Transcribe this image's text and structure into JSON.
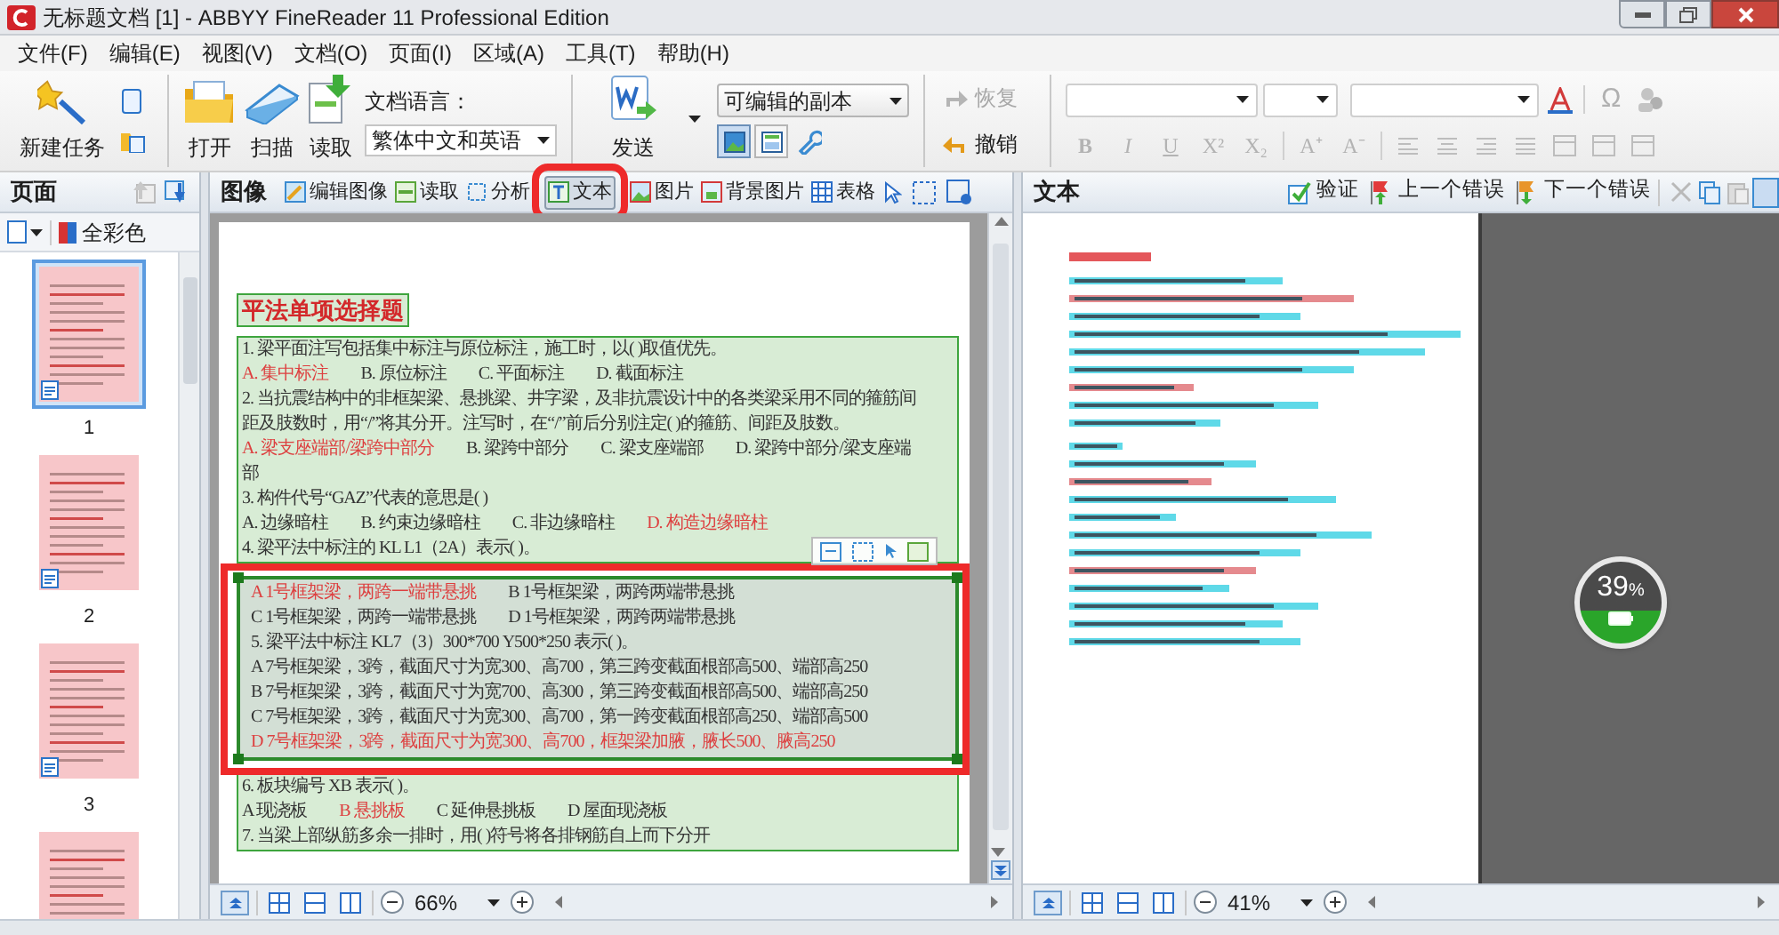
{
  "window": {
    "title": "无标题文档 [1] - ABBYY FineReader 11 Professional Edition"
  },
  "menu": [
    "文件(F)",
    "编辑(E)",
    "视图(V)",
    "文档(O)",
    "页面(I)",
    "区域(A)",
    "工具(T)",
    "帮助(H)"
  ],
  "toolbar": {
    "new_task": "新建任务",
    "main_buttons": [
      "打开",
      "扫描",
      "读取"
    ],
    "language": {
      "label": "文档语言：",
      "value": "繁体中文和英语"
    },
    "send": {
      "label": "发送",
      "format": "可编辑的副本",
      "views": [
        {
          "selected": true
        },
        {
          "selected": false
        }
      ]
    },
    "history": [
      {
        "label": "恢复",
        "disabled": true
      },
      {
        "label": "撤销",
        "disabled": false
      }
    ],
    "format_buttons": [
      "B",
      "I",
      "U",
      "X²",
      "X₂",
      "A⁺",
      "A⁻"
    ],
    "special_char": "Ω"
  },
  "pages_panel": {
    "title": "页面",
    "color_mode": "全彩色",
    "pages": [
      {
        "number": "1",
        "selected": true
      },
      {
        "number": "2",
        "selected": false
      },
      {
        "number": "3",
        "selected": false
      },
      {
        "selected": false
      }
    ]
  },
  "image_panel": {
    "title": "图像",
    "tools": [
      {
        "label": "编辑图像",
        "selected": false
      },
      {
        "label": "读取",
        "selected": false
      },
      {
        "label": "分析",
        "selected": false
      },
      {
        "label": "文本",
        "selected": true,
        "highlighted": true
      },
      {
        "label": "图片",
        "selected": false
      },
      {
        "label": "背景图片",
        "selected": false
      },
      {
        "label": "表格",
        "selected": false
      }
    ],
    "document": {
      "title": "平法单项选择题",
      "regions": [
        {
          "selected": false,
          "lines": [
            [
              {
                "text": "1. 梁平面注写包括集中标注与原位标注，施工时，以( )取值优先。",
                "answer": false
              }
            ],
            [
              {
                "text": "A. 集中标注",
                "answer": true
              },
              {
                "text": "B. 原位标注",
                "answer": false
              },
              {
                "text": "C. 平面标注",
                "answer": false
              },
              {
                "text": "D. 截面标注",
                "answer": false
              }
            ],
            [
              {
                "text": "2. 当抗震结构中的非框架梁、悬挑梁、井字梁，及非抗震设计中的各类梁采用不同的箍筋间",
                "answer": false
              }
            ],
            [
              {
                "text": "距及肢数时，用“/”将其分开。注写时，在“/”前后分别注定(    )的箍筋、间距及肢数。",
                "answer": false
              }
            ],
            [
              {
                "text": "A. 梁支座端部/梁跨中部分",
                "answer": true
              },
              {
                "text": "B. 梁跨中部分",
                "answer": false
              },
              {
                "text": "C. 梁支座端部",
                "answer": false
              },
              {
                "text": "D. 梁跨中部分/梁支座端",
                "answer": false
              }
            ],
            [
              {
                "text": "部",
                "answer": false
              }
            ],
            [
              {
                "text": "3. 构件代号“GAZ”代表的意思是(      )",
                "answer": false
              }
            ],
            [
              {
                "text": "A. 边缘暗柱",
                "answer": false
              },
              {
                "text": "B. 约束边缘暗柱",
                "answer": false
              },
              {
                "text": "C. 非边缘暗柱",
                "answer": false
              },
              {
                "text": "D. 构造边缘暗柱",
                "answer": true
              }
            ],
            [
              {
                "text": "4. 梁平法中标注的 KL L1（2A）表示(       )。",
                "answer": false
              }
            ]
          ]
        },
        {
          "selected": true,
          "lines": [
            [
              {
                "text": "A  1号框架梁，两跨一端带悬挑",
                "answer": true
              },
              {
                "text": "B    1号框架梁，两跨两端带悬挑",
                "answer": false
              }
            ],
            [
              {
                "text": "C  1号框架梁，两跨一端带悬挑",
                "answer": false
              },
              {
                "text": "D    1号框架梁，两跨两端带悬挑",
                "answer": false
              }
            ],
            [
              {
                "text": "5. 梁平法中标注 KL7（3）300*700 Y500*250 表示(       )。",
                "answer": false
              }
            ],
            [
              {
                "text": "A  7号框架梁，3跨，截面尺寸为宽300、高700，第三跨变截面根部高500、端部高250",
                "answer": false
              }
            ],
            [
              {
                "text": "B  7号框架梁，3跨，截面尺寸为宽700、高300，第三跨变截面根部高500、端部高250",
                "answer": false
              }
            ],
            [
              {
                "text": "C  7号框架梁，3跨，截面尺寸为宽300、高700，第一跨变截面根部高250、端部高500",
                "answer": false
              }
            ],
            [
              {
                "text": "D  7号框架梁，3跨，截面尺寸为宽300、高700，框架梁加腋，腋长500、腋高250",
                "answer": true
              }
            ]
          ]
        },
        {
          "selected": false,
          "lines": [
            [
              {
                "text": "6. 板块编号 XB 表示(        )。",
                "answer": false
              }
            ],
            [
              {
                "text": "A  现浇板",
                "answer": false
              },
              {
                "text": "B 悬挑板",
                "answer": true
              },
              {
                "text": "C  延伸悬挑板",
                "answer": false
              },
              {
                "text": "D  屋面现浇板",
                "answer": false
              }
            ],
            [
              {
                "text": "7. 当梁上部纵筋多余一排时，用(      )符号将各排钢筋自上而下分开",
                "answer": false
              }
            ]
          ]
        }
      ]
    },
    "zoom": "66%"
  },
  "text_panel": {
    "title": "文本",
    "tools": [
      "验证",
      "上一个错误",
      "下一个错误"
    ],
    "zoom": "41%"
  },
  "battery_widget": {
    "percent": "39",
    "unit": "%"
  }
}
